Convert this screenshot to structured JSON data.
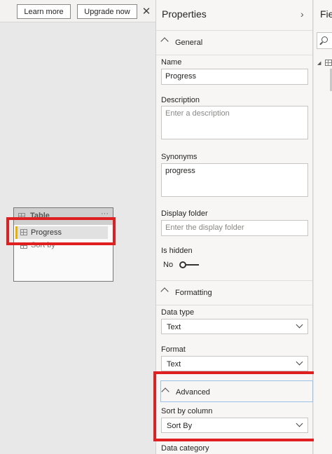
{
  "toolbar": {
    "learn_more": "Learn more",
    "upgrade_now": "Upgrade now",
    "close": "✕"
  },
  "canvas": {
    "table_card": {
      "title": "Table",
      "more": "···",
      "fields": [
        {
          "label": "Progress",
          "selected": true
        },
        {
          "label": "Sort by",
          "selected": false
        }
      ]
    }
  },
  "properties": {
    "title": "Properties",
    "collapse": "›",
    "general": {
      "title": "General",
      "name_label": "Name",
      "name_value": "Progress",
      "description_label": "Description",
      "description_placeholder": "Enter a description",
      "synonyms_label": "Synonyms",
      "synonyms_value": "progress",
      "display_folder_label": "Display folder",
      "display_folder_placeholder": "Enter the display folder",
      "is_hidden_label": "Is hidden",
      "is_hidden_value": "No"
    },
    "formatting": {
      "title": "Formatting",
      "data_type_label": "Data type",
      "data_type_value": "Text",
      "format_label": "Format",
      "format_value": "Text"
    },
    "advanced": {
      "title": "Advanced",
      "sort_by_label": "Sort by column",
      "sort_by_value": "Sort By",
      "data_category_label": "Data category"
    }
  },
  "fields_pane": {
    "title": "Fie"
  },
  "colors": {
    "highlight": "#e02020",
    "selected_bar": "#e8b000",
    "focus_border": "#9ac2e6"
  }
}
